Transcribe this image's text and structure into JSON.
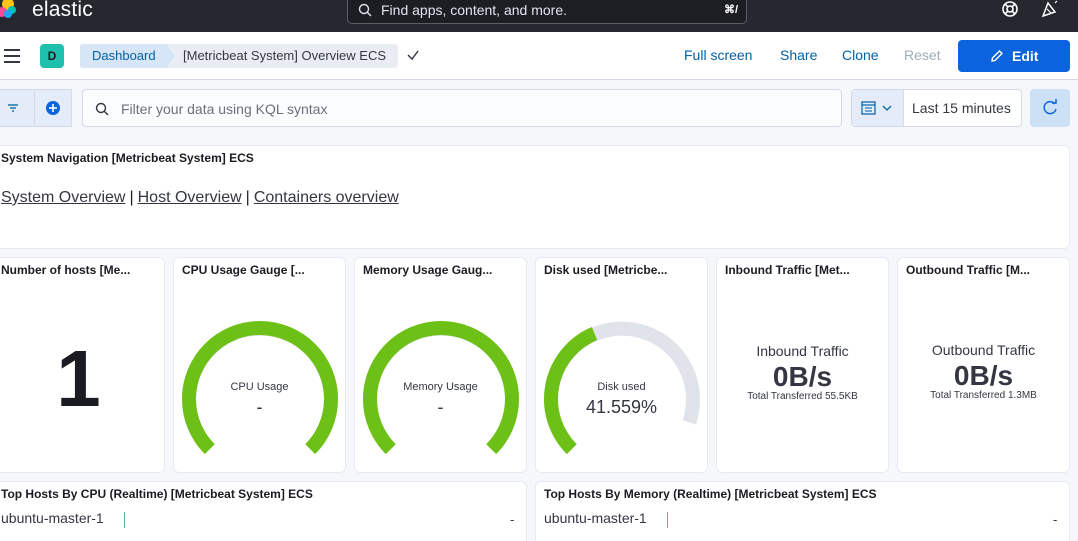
{
  "header": {
    "brand": "elastic",
    "search_placeholder": "Find apps, content, and more.",
    "search_shortcut": "⌘/",
    "icons": [
      "elastic-logo-icon",
      "search-icon",
      "help-icon",
      "newsfeed-icon"
    ]
  },
  "subheader": {
    "avatar_letter": "D",
    "breadcrumbs": [
      "Dashboard",
      "[Metricbeat System] Overview ECS"
    ],
    "actions": {
      "full_screen": "Full screen",
      "share": "Share",
      "clone": "Clone",
      "reset": "Reset",
      "edit": "Edit"
    }
  },
  "query": {
    "placeholder": "Filter your data using KQL syntax",
    "time_range": "Last 15 minutes"
  },
  "colors": {
    "gauge_green": "#6dc116",
    "gauge_track": "#e0e3e9",
    "accent": "#0b64dd"
  },
  "panels": {
    "navigation": {
      "title": "System Navigation [Metricbeat System] ECS",
      "links": [
        "System Overview",
        "Host Overview",
        "Containers overview"
      ],
      "separator": "|"
    },
    "hosts": {
      "title": "Number of hosts [Me...",
      "value": "1"
    },
    "cpu": {
      "title": "CPU Usage Gauge [...",
      "label": "CPU Usage",
      "value": "-",
      "fill_fraction": 1.0
    },
    "memory": {
      "title": "Memory Usage Gaug...",
      "label": "Memory Usage",
      "value": "-",
      "fill_fraction": 1.0
    },
    "disk": {
      "title": "Disk used [Metricbe...",
      "label": "Disk used",
      "value": "41.559%",
      "fill_fraction": 0.41559
    },
    "inbound": {
      "title": "Inbound Traffic [Met...",
      "heading": "Inbound Traffic",
      "value": "0B/s",
      "sub": "Total Transferred 55.5KB"
    },
    "outbound": {
      "title": "Outbound Traffic [M...",
      "heading": "Outbound Traffic",
      "value": "0B/s",
      "sub": "Total Transferred 1.3MB"
    },
    "top_cpu": {
      "title": "Top Hosts By CPU (Realtime) [Metricbeat System] ECS",
      "host": "ubuntu-master-1",
      "value": "-"
    },
    "top_mem": {
      "title": "Top Hosts By Memory (Realtime) [Metricbeat System] ECS",
      "host": "ubuntu-master-1",
      "value": "-"
    }
  }
}
